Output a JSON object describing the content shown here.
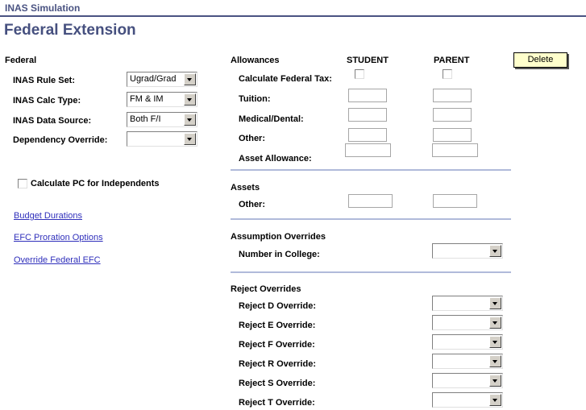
{
  "header": {
    "breadcrumb": "INAS Simulation",
    "page_title": "Federal Extension",
    "accent_color": "#4a5382"
  },
  "toolbar": {
    "delete_label": "Delete",
    "delete_bg": "#ffffcc"
  },
  "federal_section": {
    "heading": "Federal",
    "fields": [
      {
        "label": "INAS Rule Set:",
        "value": "Ugrad/Grad"
      },
      {
        "label": "INAS Calc Type:",
        "value": "FM & IM"
      },
      {
        "label": "INAS Data Source:",
        "value": "Both F/I"
      },
      {
        "label": "Dependency Override:",
        "value": ""
      }
    ],
    "checkbox": {
      "label": "Calculate PC for Independents",
      "checked": false
    },
    "links": [
      {
        "label": "Budget Durations"
      },
      {
        "label": "EFC Proration Options"
      },
      {
        "label": "Override Federal EFC"
      }
    ],
    "link_color": "#2f2fbb"
  },
  "allowances_section": {
    "heading": "Allowances",
    "columns": [
      "STUDENT",
      "PARENT"
    ],
    "rows": [
      {
        "label": "Calculate Federal Tax:",
        "type": "checkbox",
        "student": false,
        "parent": false
      },
      {
        "label": "Tuition:",
        "type": "text",
        "student": "",
        "parent": ""
      },
      {
        "label": "Medical/Dental:",
        "type": "text",
        "student": "",
        "parent": ""
      },
      {
        "label": "Other:",
        "type": "text",
        "student": "",
        "parent": ""
      },
      {
        "label": "Asset Allowance:",
        "type": "text",
        "student": "",
        "parent": ""
      }
    ]
  },
  "assets_section": {
    "heading": "Assets",
    "rows": [
      {
        "label": "Other:",
        "student": "",
        "parent": ""
      }
    ]
  },
  "assumption_section": {
    "heading": "Assumption Overrides",
    "rows": [
      {
        "label": "Number in College:",
        "value": ""
      }
    ]
  },
  "reject_section": {
    "heading": "Reject Overrides",
    "rows": [
      {
        "label": "Reject D Override:",
        "value": ""
      },
      {
        "label": "Reject E Override:",
        "value": ""
      },
      {
        "label": "Reject F Override:",
        "value": ""
      },
      {
        "label": "Reject R Override:",
        "value": ""
      },
      {
        "label": "Reject S Override:",
        "value": ""
      },
      {
        "label": "Reject T Override:",
        "value": ""
      }
    ]
  }
}
